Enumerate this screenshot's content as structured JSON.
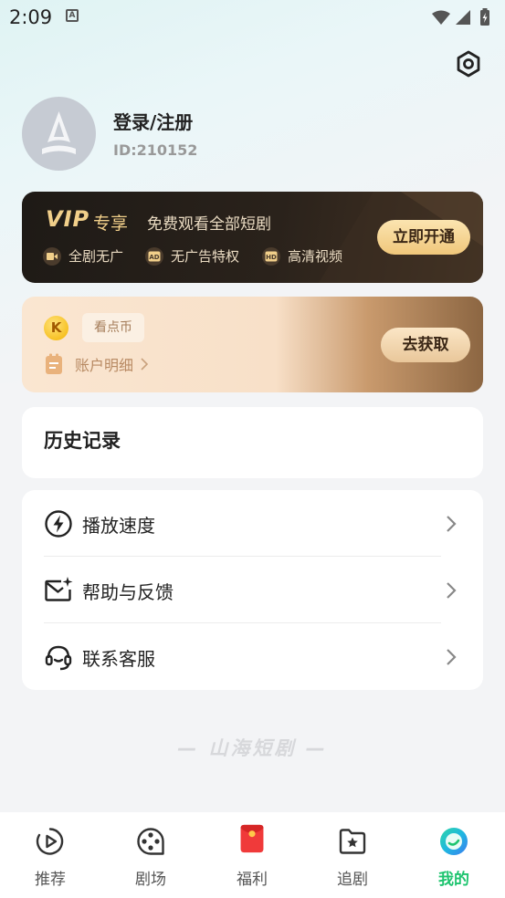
{
  "status_bar": {
    "time": "2:09",
    "badge": "A"
  },
  "profile": {
    "title": "登录/注册",
    "id": "ID:210152"
  },
  "vip": {
    "logo": "VIP",
    "logo_sub": "专享",
    "desc": "免费观看全部短剧",
    "features": [
      "全剧无广",
      "无广告特权",
      "高清视频"
    ],
    "cta": "立即开通"
  },
  "coin": {
    "symbol": "K",
    "label": "看点币",
    "account_detail": "账户明细",
    "cta": "去获取"
  },
  "history": {
    "title": "历史记录"
  },
  "menu": {
    "items": [
      {
        "label": "播放速度",
        "icon": "lightning-icon"
      },
      {
        "label": "帮助与反馈",
        "icon": "mail-sparkle-icon"
      },
      {
        "label": "联系客服",
        "icon": "headset-icon"
      }
    ]
  },
  "brand": "— 山海短剧 —",
  "nav": {
    "items": [
      {
        "label": "推荐",
        "icon": "play-circle-icon"
      },
      {
        "label": "剧场",
        "icon": "film-reel-icon"
      },
      {
        "label": "福利",
        "icon": "red-envelope-icon"
      },
      {
        "label": "追剧",
        "icon": "folder-star-icon"
      },
      {
        "label": "我的",
        "icon": "profile-orb-icon"
      }
    ],
    "active_index": 4
  },
  "colors": {
    "accent_green": "#1ec46f",
    "vip_gold": "#f1cf8a",
    "vip_dark": "#1e1a16",
    "coin_cream": "#fae6d1"
  }
}
